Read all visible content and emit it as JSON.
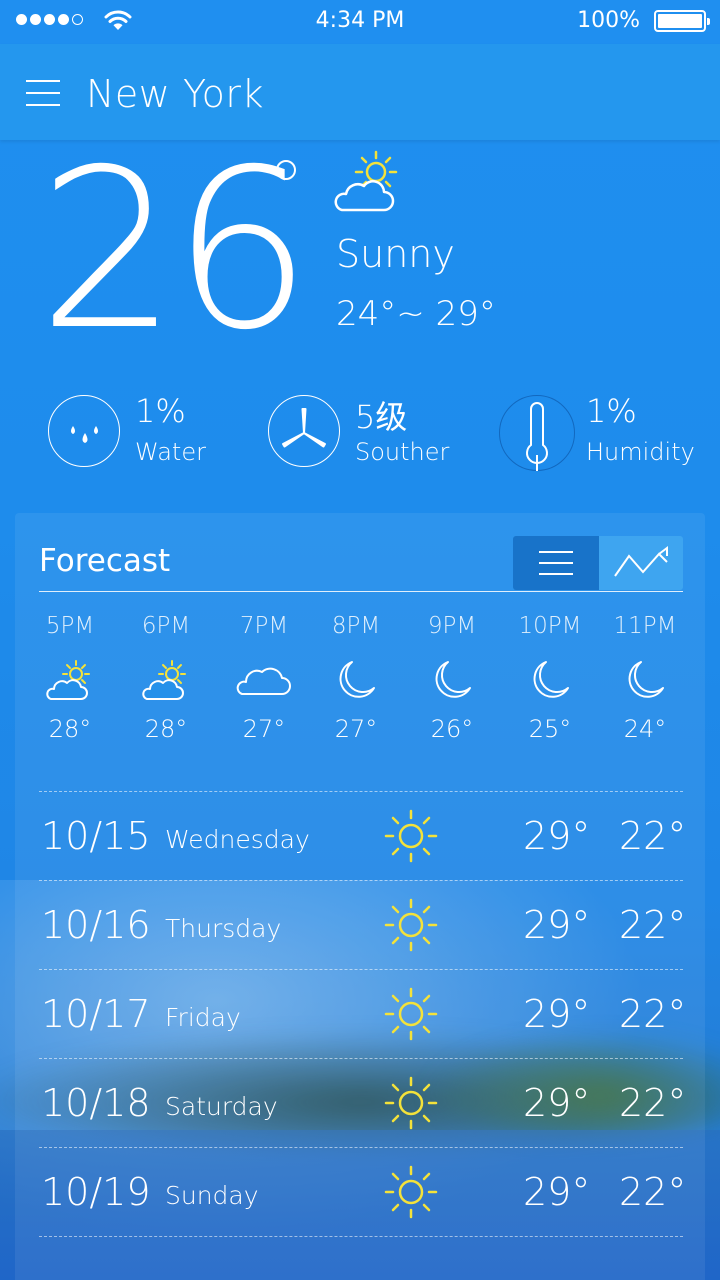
{
  "status_bar": {
    "time": "4:34 PM",
    "battery": "100%",
    "signal_bars": 4,
    "signal_total": 5
  },
  "header": {
    "city": "New York",
    "menu_icon": "hamburger-menu-icon"
  },
  "current": {
    "temperature": "26",
    "condition": "Sunny",
    "range": "24°~ 29°",
    "icon": "partly-cloudy-sun-icon"
  },
  "metrics": [
    {
      "value": "1%",
      "label": "Water",
      "icon": "water-drops-icon"
    },
    {
      "value": "5级",
      "label": "Souther",
      "icon": "wind-turbine-icon"
    },
    {
      "value": "1%",
      "label": "Humidity",
      "icon": "thermometer-icon"
    }
  ],
  "forecast": {
    "title": "Forecast",
    "views": [
      "list-view-icon",
      "chart-view-icon"
    ],
    "hourly": [
      {
        "time": "5PM",
        "temp": "28°",
        "icon": "partly-cloudy-sun-icon"
      },
      {
        "time": "6PM",
        "temp": "28°",
        "icon": "partly-cloudy-sun-icon"
      },
      {
        "time": "7PM",
        "temp": "27°",
        "icon": "cloud-icon"
      },
      {
        "time": "8PM",
        "temp": "27°",
        "icon": "moon-icon"
      },
      {
        "time": "9PM",
        "temp": "26°",
        "icon": "moon-icon"
      },
      {
        "time": "10PM",
        "temp": "25°",
        "icon": "moon-icon"
      },
      {
        "time": "11PM",
        "temp": "24°",
        "icon": "moon-icon"
      }
    ],
    "daily": [
      {
        "date": "10/15",
        "day": "Wednesday",
        "high": "29°",
        "low": "22°",
        "icon": "sun-icon"
      },
      {
        "date": "10/16",
        "day": "Thursday",
        "high": "29°",
        "low": "22°",
        "icon": "sun-icon"
      },
      {
        "date": "10/17",
        "day": "Friday",
        "high": "29°",
        "low": "22°",
        "icon": "sun-icon"
      },
      {
        "date": "10/18",
        "day": "Saturday",
        "high": "29°",
        "low": "22°",
        "icon": "sun-icon"
      },
      {
        "date": "10/19",
        "day": "Sunday",
        "high": "29°",
        "low": "22°",
        "icon": "sun-icon"
      }
    ]
  },
  "colors": {
    "background": "#1e8cec",
    "header": "#2497ee",
    "sun": "#f4e23a",
    "toggle_active": "#3ea5f0",
    "toggle_inactive": "#1873c9"
  }
}
